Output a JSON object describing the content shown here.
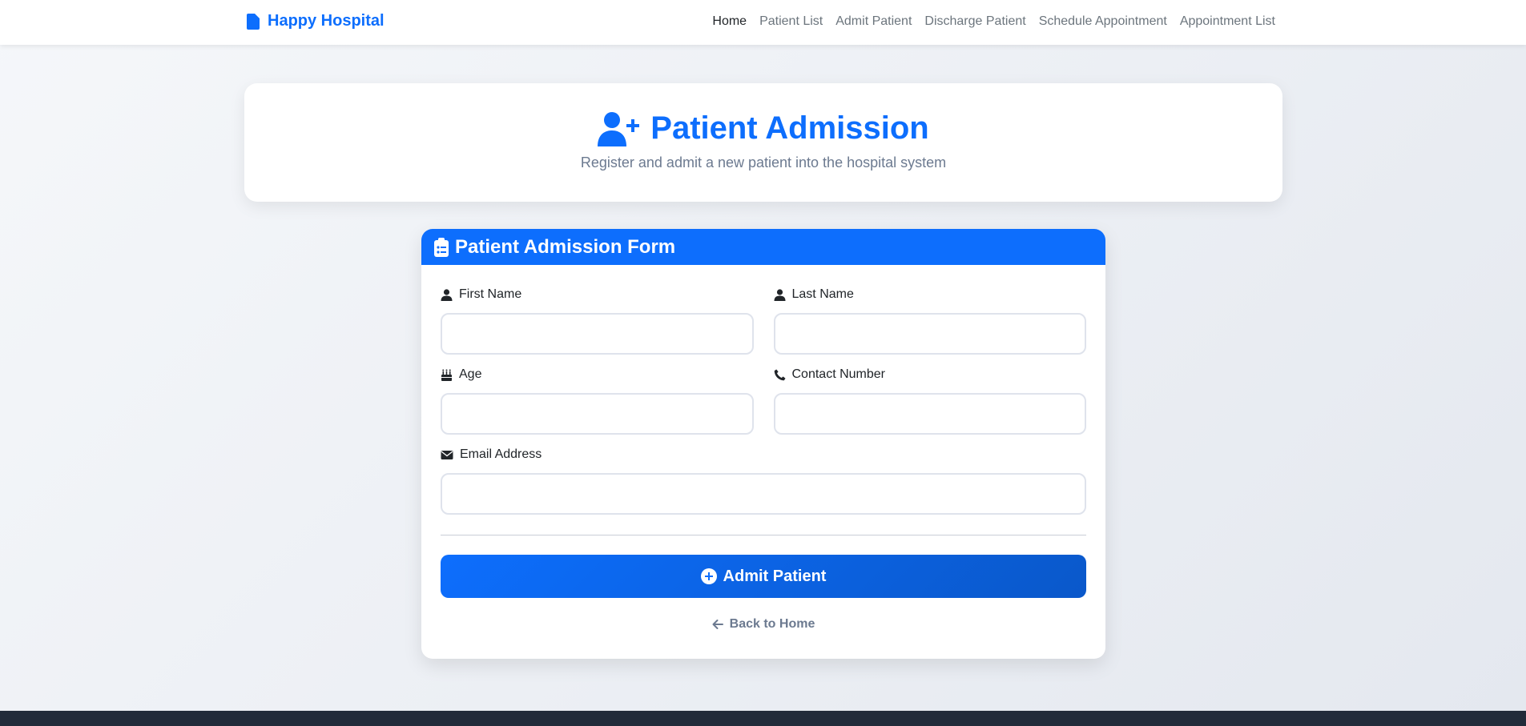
{
  "brand": {
    "name": "Happy Hospital",
    "color": "#0d6efd"
  },
  "nav": {
    "items": [
      {
        "label": "Home",
        "active": true
      },
      {
        "label": "Patient List",
        "active": false
      },
      {
        "label": "Admit Patient",
        "active": false
      },
      {
        "label": "Discharge Patient",
        "active": false
      },
      {
        "label": "Schedule Appointment",
        "active": false
      },
      {
        "label": "Appointment List",
        "active": false
      }
    ]
  },
  "header": {
    "icon": "user-plus-icon",
    "title": "Patient Admission",
    "subtitle": "Register and admit a new patient into the hospital system"
  },
  "form": {
    "icon": "clipboard-list-icon",
    "title": "Patient Admission Form",
    "fields": {
      "first_name": {
        "label": "First Name",
        "value": "",
        "icon": "user-icon"
      },
      "last_name": {
        "label": "Last Name",
        "value": "",
        "icon": "user-icon"
      },
      "age": {
        "label": "Age",
        "value": "",
        "icon": "birthday-cake-icon"
      },
      "contact": {
        "label": "Contact Number",
        "value": "",
        "icon": "phone-icon"
      },
      "email": {
        "label": "Email Address",
        "value": "",
        "icon": "envelope-icon"
      }
    },
    "submit_label": "Admit Patient",
    "back_label": "Back to Home"
  },
  "colors": {
    "primary": "#0d6efd",
    "footer": "#222b3a",
    "muted": "#6c7a90"
  }
}
